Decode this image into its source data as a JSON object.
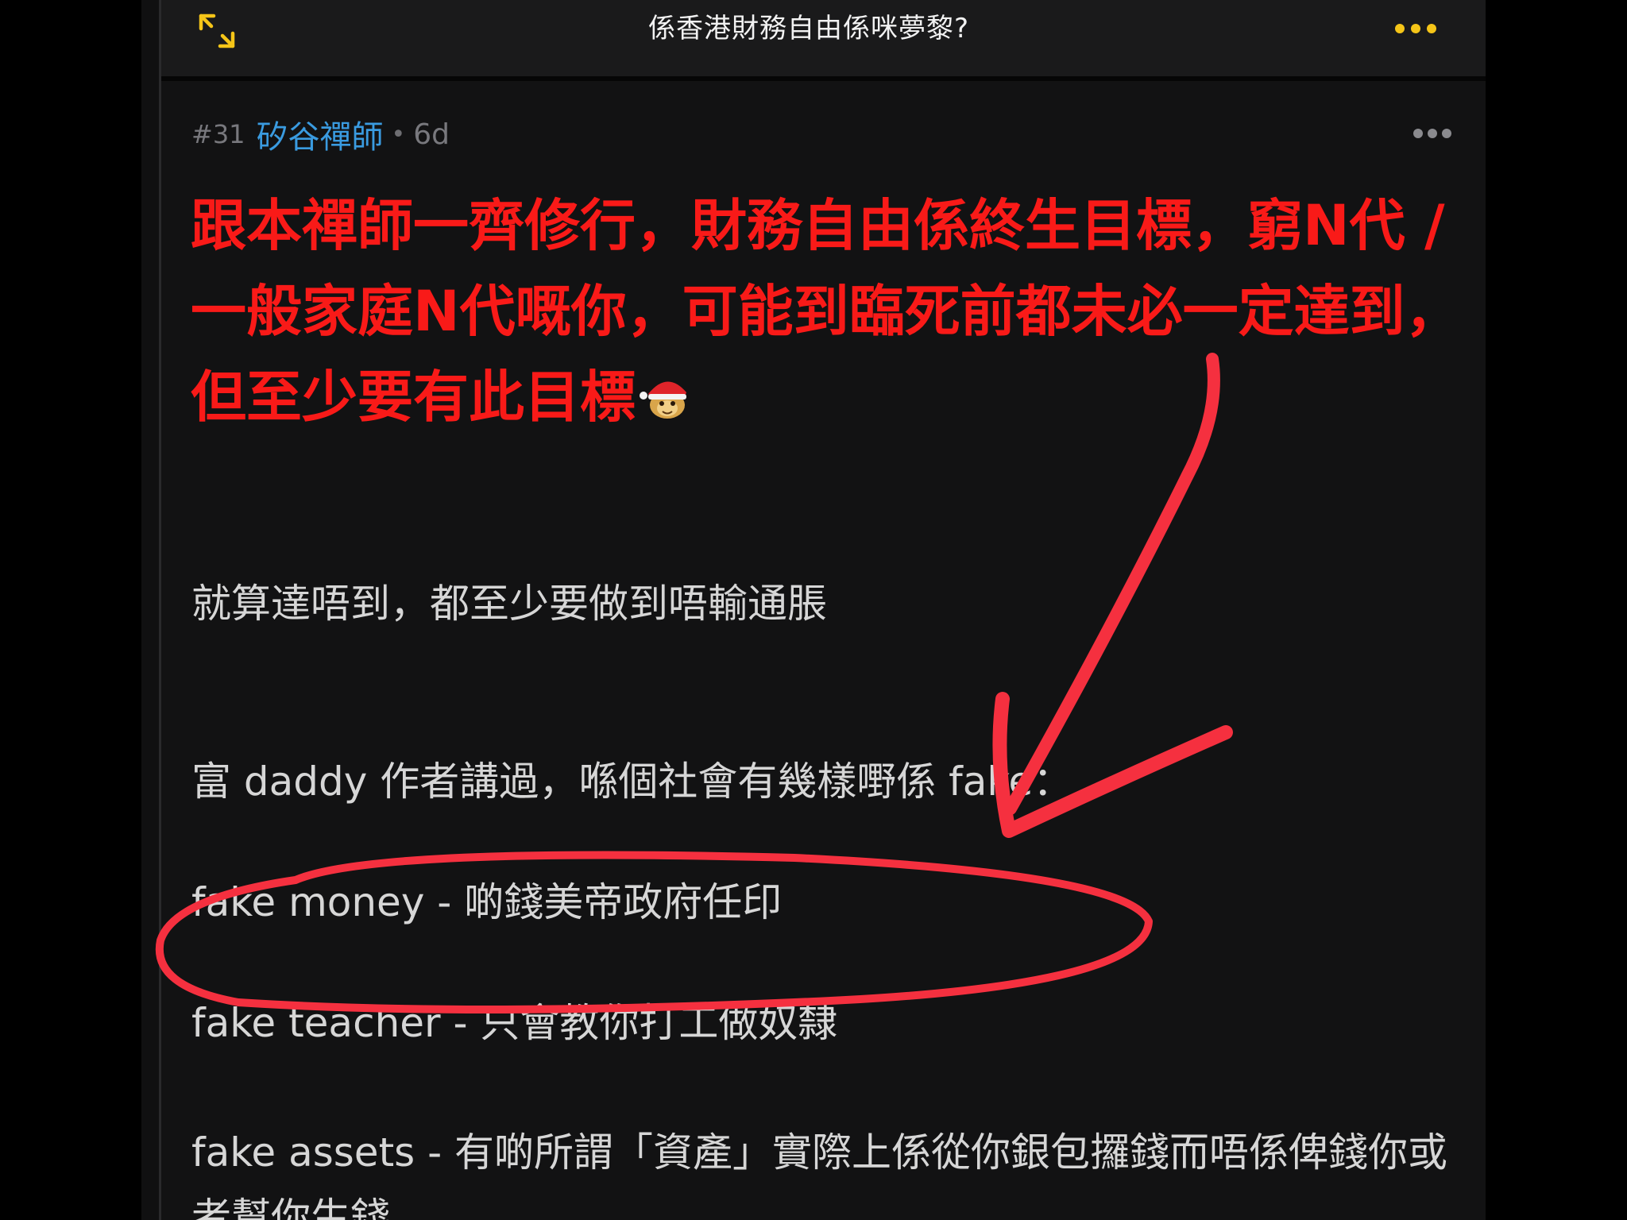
{
  "header": {
    "title": "係香港財務自由係咪夢黎?",
    "expand_icon": "expand-arrows-icon",
    "more_icon": "more-dots-icon"
  },
  "post": {
    "number": "#31",
    "username": "矽谷禪師",
    "separator": "•",
    "age": "6d",
    "more_icon": "more-dots-icon",
    "highlight": "跟本禪師一齊修行，財務自由係終生目標，窮N代 / 一般家庭N代嘅你，可能到臨死前都未必一定達到，但至少要有此目標",
    "emoji": "santa-monkey-emoji",
    "paragraphs": [
      "就算達唔到，都至少要做到唔輸通脹",
      "富 daddy 作者講過，喺個社會有幾樣嘢係 fake：",
      "fake money - 啲錢美帝政府任印",
      "fake teacher - 只會教你打工做奴隸",
      "fake assets - 有啲所謂「資產」實際上係從你銀包攞錢而唔係俾錢你或者幫你生錢"
    ]
  },
  "colors": {
    "background": "#121213",
    "highlight": "#f91a18",
    "username": "#3a9be0",
    "body_text": "#d6d6d6",
    "annotation": "#f5303f",
    "more_dots": "#f5c518"
  }
}
